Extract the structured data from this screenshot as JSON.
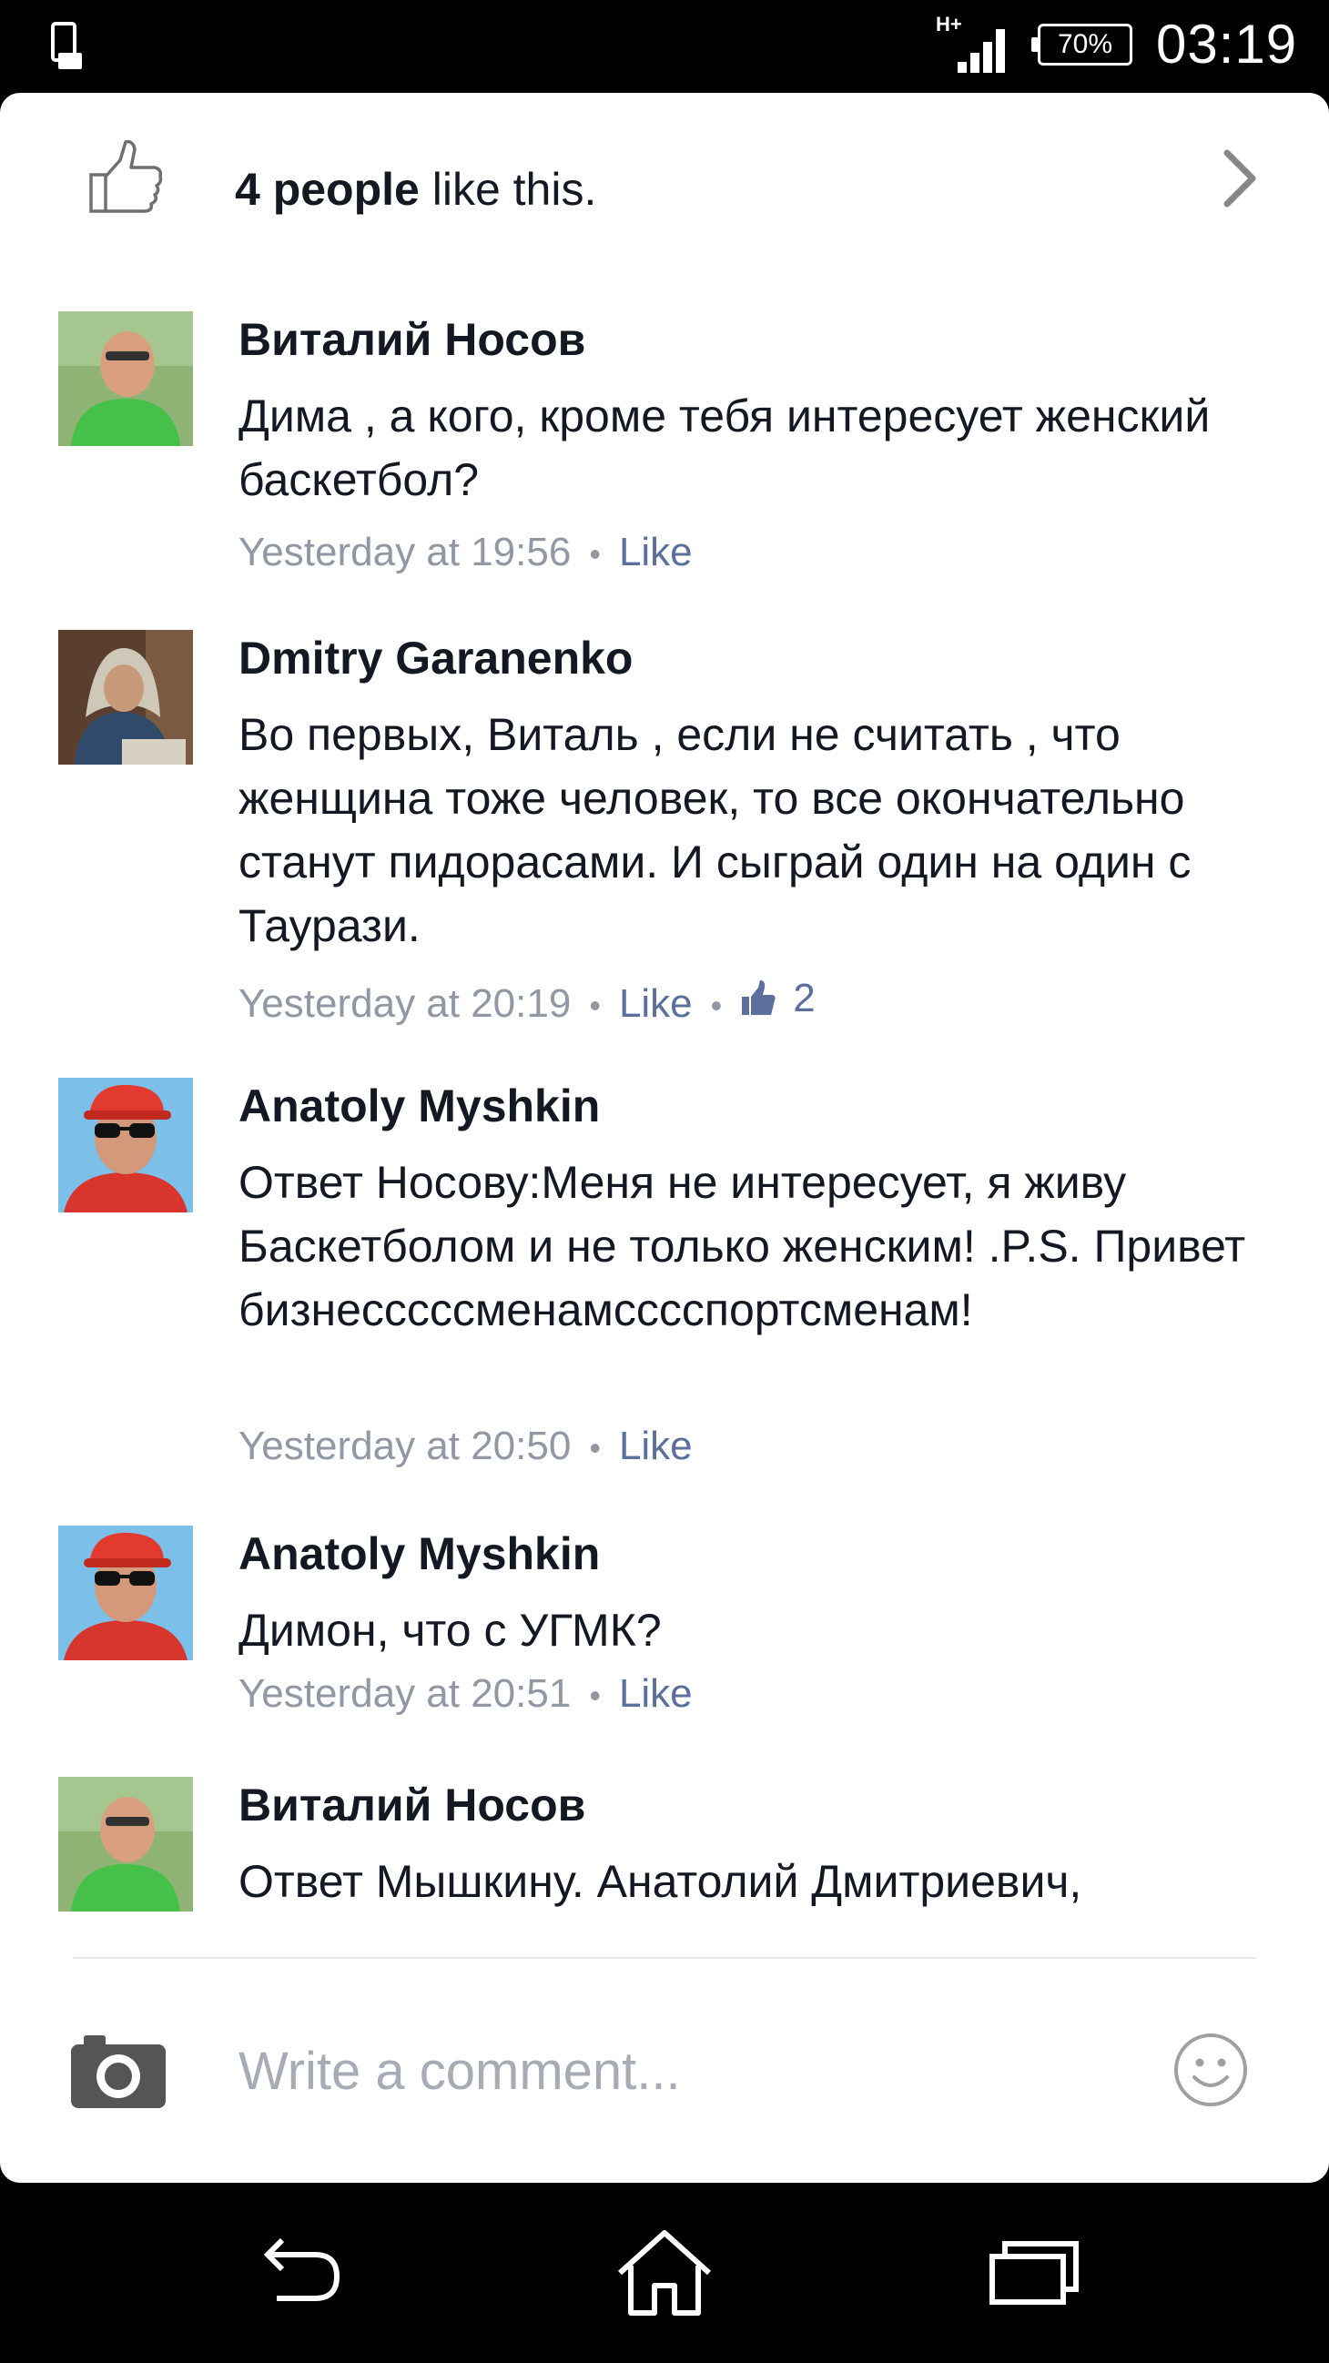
{
  "status_bar": {
    "network_type": "H+",
    "battery": "70%",
    "time": "03:19"
  },
  "likes": {
    "count_text": "4 people",
    "suffix": " like this."
  },
  "comments": [
    {
      "author": "Виталий Носов",
      "text": "Дима , а кого, кроме тебя интересует женский баскетбол?",
      "time": "Yesterday at 19:56",
      "like_label": "Like",
      "avatar_palette": {
        "bg": "#8fb275",
        "skin": "#d8a07e",
        "shirt": "#45c14a"
      }
    },
    {
      "author": "Dmitry Garanenko",
      "text": "Во первых, Виталь , если не считать , что женщина тоже человек, то все окончательно станут пидорасами. И сыграй один на один с Таурази.",
      "time": "Yesterday at 20:19",
      "like_label": "Like",
      "reaction_count": "2",
      "avatar_palette": {
        "bg": "#5a3e2e",
        "skin": "#c89a7c",
        "shirt": "#2f4a6a"
      }
    },
    {
      "author": "Anatoly  Myshkin",
      "text": "Ответ Носову:Меня не интересует, я живу Баскетболом и не только женским! .P.S. Привет бизнесссссменамсссспортсменам!",
      "time": "Yesterday at 20:50",
      "like_label": "Like",
      "avatar_palette": {
        "bg": "#7cbfe8",
        "skin": "#d4987a",
        "shirt": "#d8352d"
      }
    },
    {
      "author": "Anatoly  Myshkin",
      "text": "Димон, что с УГМК?",
      "time": "Yesterday at 20:51",
      "like_label": "Like",
      "avatar_palette": {
        "bg": "#7cbfe8",
        "skin": "#d4987a",
        "shirt": "#d8352d"
      }
    },
    {
      "author": "Виталий Носов",
      "text": "Ответ Мышкину. Анатолий Дмитриевич,",
      "avatar_palette": {
        "bg": "#8fb275",
        "skin": "#d8a07e",
        "shirt": "#45c14a"
      }
    }
  ],
  "composer": {
    "placeholder": "Write a comment..."
  },
  "colors": {
    "text": "#141823",
    "meta": "#9197a3",
    "link": "#5b6f9d",
    "icon": "#707070"
  },
  "icons": {
    "likes": "thumbs-up-outline-icon",
    "chevron": "chevron-right-icon",
    "camera": "camera-icon",
    "emoji": "smiley-icon",
    "back": "back-icon",
    "home": "home-icon",
    "recents": "recent-apps-icon"
  }
}
